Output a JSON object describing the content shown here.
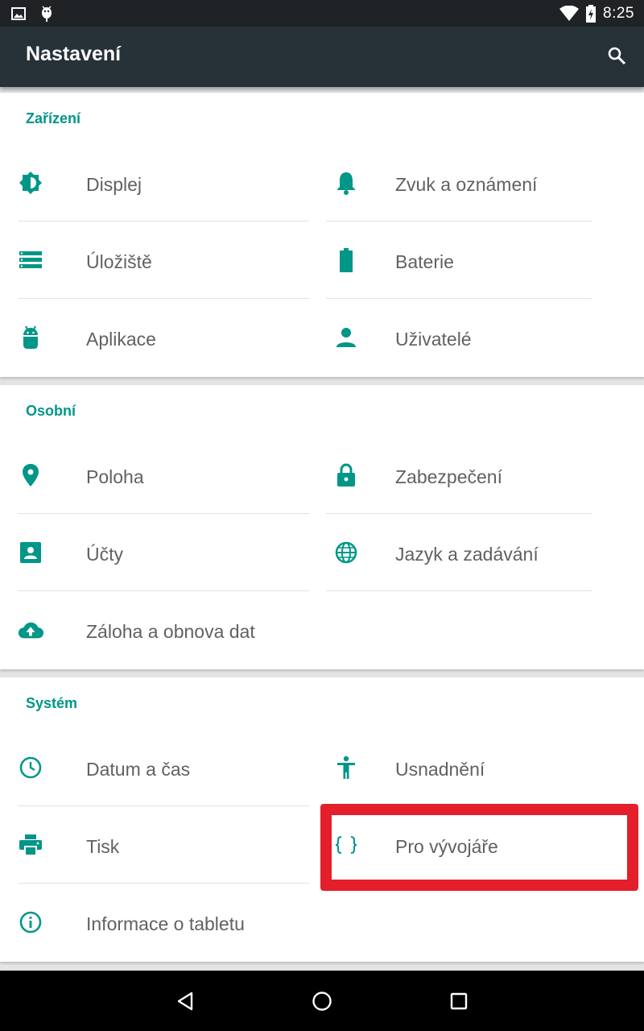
{
  "status_bar": {
    "time": "8:25",
    "left_icons": [
      "image-icon",
      "android-debug-icon"
    ],
    "right_icons": [
      "wifi-icon",
      "battery-charging-icon"
    ]
  },
  "app_bar": {
    "title": "Nastavení",
    "search_icon": "search-icon"
  },
  "accent_color": "#009688",
  "sections": [
    {
      "title": "Zařízení",
      "items": [
        {
          "label": "Displej",
          "icon": "brightness-icon"
        },
        {
          "label": "Zvuk a oznámení",
          "icon": "bell-icon"
        },
        {
          "label": "Úložiště",
          "icon": "storage-icon"
        },
        {
          "label": "Baterie",
          "icon": "battery-icon"
        },
        {
          "label": "Aplikace",
          "icon": "android-icon"
        },
        {
          "label": "Uživatelé",
          "icon": "person-icon"
        }
      ]
    },
    {
      "title": "Osobní",
      "items": [
        {
          "label": "Poloha",
          "icon": "location-pin-icon"
        },
        {
          "label": "Zabezpečení",
          "icon": "lock-icon"
        },
        {
          "label": "Účty",
          "icon": "account-box-icon"
        },
        {
          "label": "Jazyk a zadávání",
          "icon": "globe-icon"
        },
        {
          "label": "Záloha a obnova dat",
          "icon": "cloud-upload-icon"
        }
      ]
    },
    {
      "title": "Systém",
      "items": [
        {
          "label": "Datum a čas",
          "icon": "clock-icon"
        },
        {
          "label": "Usnadnění",
          "icon": "accessibility-icon"
        },
        {
          "label": "Tisk",
          "icon": "printer-icon"
        },
        {
          "label": "Pro vývojáře",
          "icon": "developer-braces-icon",
          "highlighted": true
        },
        {
          "label": "Informace o tabletu",
          "icon": "info-icon"
        }
      ]
    }
  ],
  "nav_bar": {
    "buttons": [
      "back-icon",
      "home-icon",
      "recents-icon"
    ]
  }
}
